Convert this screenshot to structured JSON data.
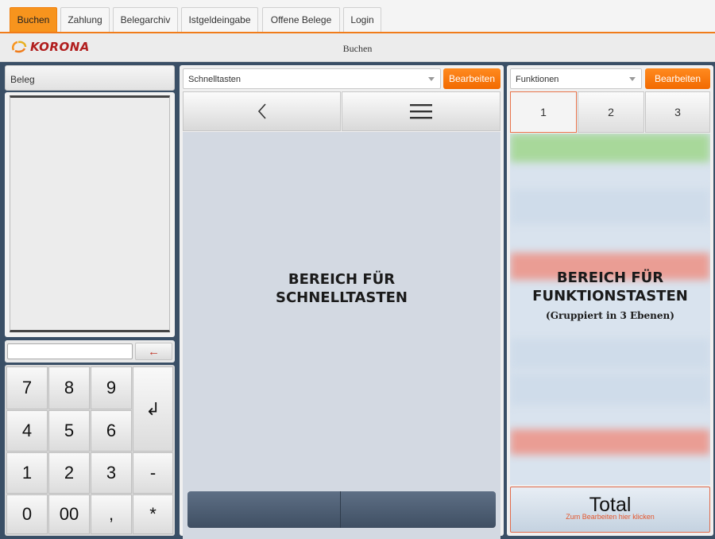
{
  "tabs": [
    {
      "label": "Buchen",
      "active": true
    },
    {
      "label": "Zahlung"
    },
    {
      "label": "Belegarchiv"
    },
    {
      "label": "Istgeldeingabe"
    },
    {
      "label": "Offene Belege"
    },
    {
      "label": "Login"
    }
  ],
  "header": {
    "logo_text": "KORONA",
    "title": "Buchen"
  },
  "left": {
    "beleg_label": "Beleg",
    "input_value": "",
    "backspace_glyph": "←",
    "keys": {
      "k7": "7",
      "k8": "8",
      "k9": "9",
      "enter": "↲",
      "k4": "4",
      "k5": "5",
      "k6": "6",
      "k1": "1",
      "k2": "2",
      "k3": "3",
      "minus": "-",
      "k0": "0",
      "k00": "00",
      "comma": ",",
      "star": "*"
    }
  },
  "middle": {
    "select_value": "Schnelltasten",
    "edit_label": "Bearbeiten",
    "area_line1": "BEREICH FÜR",
    "area_line2": "SCHNELLTASTEN"
  },
  "right": {
    "select_value": "Funktionen",
    "edit_label": "Bearbeiten",
    "levels": [
      "1",
      "2",
      "3"
    ],
    "area_line1": "BEREICH FÜR",
    "area_line2": "FUNKTIONSTASTEN",
    "area_line3": "(Gruppiert in 3 Ebenen)",
    "total_label": "Total",
    "total_hint": "Zum Bearbeiten hier klicken"
  },
  "colors": {
    "accent": "#f7941d",
    "edit_button": "#f26a00",
    "logo": "#b11e1e",
    "total_border": "#e06a4a"
  }
}
